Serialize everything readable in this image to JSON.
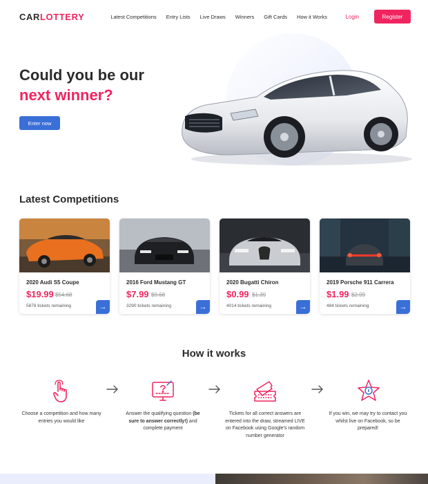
{
  "header": {
    "logo_part1": "CAR",
    "logo_part2": "LOTTERY",
    "nav": [
      "Latest Competitions",
      "Entry Lists",
      "Live Draws",
      "Winners",
      "Gift Cards",
      "How it Works"
    ],
    "login": "Login",
    "register": "Register"
  },
  "hero": {
    "title_line1": "Could you be our",
    "title_line2": "next winner?",
    "cta": "Enter now"
  },
  "competitions": {
    "title": "Latest Competitions",
    "items": [
      {
        "name": "2020 Audi S5 Coupe",
        "price": "$19.99",
        "old_price": "$54.68",
        "remaining": "5878 tickets remaining"
      },
      {
        "name": "2016 Ford Mustang GT",
        "price": "$7.99",
        "old_price": "$9.68",
        "remaining": "3290 tickets remaining"
      },
      {
        "name": "2020 Bugatti Chiron",
        "price": "$0.99",
        "old_price": "$1.39",
        "remaining": "4014 tickets remaining"
      },
      {
        "name": "2019 Porsche 911 Carrera",
        "price": "$1.99",
        "old_price": "$2.99",
        "remaining": "484 tickets remaining"
      }
    ]
  },
  "how": {
    "title": "How it works",
    "steps": [
      {
        "text": "Choose a competition and how many entries you would like",
        "icon": "pointer-hand-icon"
      },
      {
        "text_pre": "Answer the qualifying question ",
        "text_bold": "(be sure to answer correctly!)",
        "text_post": " and complete payment",
        "icon": "question-monitor-icon"
      },
      {
        "text": "Tickets for all correct answers are entered into the draw, streamed LIVE on Facebook using Google's random number generator",
        "icon": "tickets-icon"
      },
      {
        "text": "If you win, we may try to contact you whilst live on Facebook, so be prepared!",
        "icon": "prize-star-icon"
      }
    ]
  },
  "colors": {
    "accent": "#f0245f",
    "primary": "#3a6fd8",
    "text": "#2b2b2b"
  }
}
